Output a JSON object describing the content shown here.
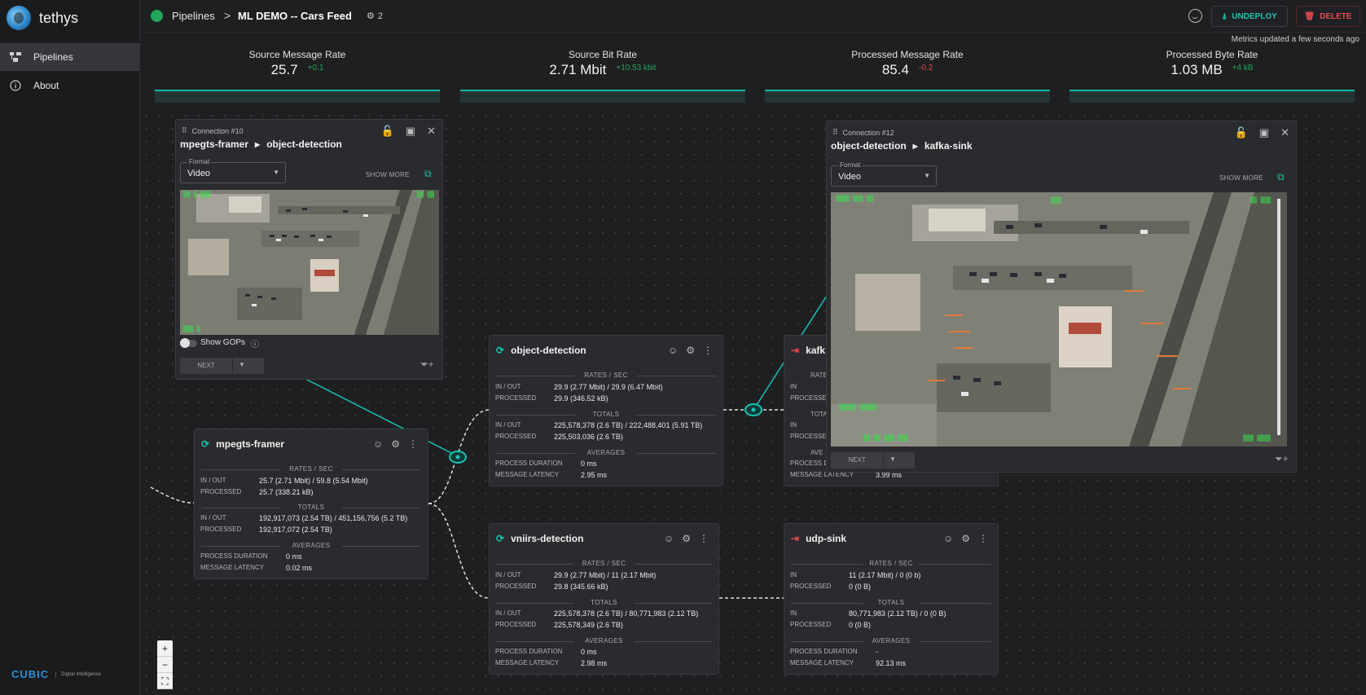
{
  "app": {
    "name": "tethys"
  },
  "sidebar": {
    "items": [
      {
        "label": "Pipelines",
        "icon": "pipelines-icon"
      },
      {
        "label": "About",
        "icon": "info-icon"
      }
    ],
    "footer": {
      "logo": "CUBIC",
      "sub": "Digital Intelligence"
    }
  },
  "header": {
    "breadcrumb_root": "Pipelines",
    "breadcrumb_sep": ">",
    "pipeline_name": "ML DEMO -- Cars Feed",
    "replica_count": "2",
    "undeploy_label": "UNDEPLOY",
    "delete_label": "DELETE",
    "status_color": "#23a55a"
  },
  "metrics": {
    "note": "Metrics updated a few seconds ago",
    "items": [
      {
        "label": "Source Message Rate",
        "value": "25.7",
        "delta": "+0.1"
      },
      {
        "label": "Source Bit Rate",
        "value": "2.71 Mbit",
        "delta": "+10.53 kbit"
      },
      {
        "label": "Processed Message Rate",
        "value": "85.4",
        "delta": "-0.2"
      },
      {
        "label": "Processed Byte Rate",
        "value": "1.03 MB",
        "delta": "+4 kB"
      }
    ]
  },
  "nodes": {
    "mpegts": {
      "title": "mpegts-framer",
      "rates_title": "RATES / SEC",
      "io_key": "IN / OUT",
      "io_val": "25.7 (2.71 Mbit)  /  59.8 (5.54 Mbit)",
      "proc_key": "PROCESSED",
      "proc_val": "25.7 (338.21 kB)",
      "totals_title": "TOTALS",
      "t_io_val": "192,917,073 (2.54 TB)  /  451,156,756 (5.2 TB)",
      "t_proc_val": "192,917,072 (2.54 TB)",
      "avg_title": "AVERAGES",
      "dur_key": "PROCESS DURATION",
      "dur_val": "0 ms",
      "lat_key": "MESSAGE LATENCY",
      "lat_val": "0.02 ms"
    },
    "objdet": {
      "title": "object-detection",
      "rates_title": "RATES / SEC",
      "io_key": "IN / OUT",
      "io_val": "29.9 (2.77 Mbit)  /  29.9 (6.47 Mbit)",
      "proc_key": "PROCESSED",
      "proc_val": "29.9 (346.52 kB)",
      "totals_title": "TOTALS",
      "t_io_val": "225,578,378 (2.6 TB)  /  222,488,401 (5.91 TB)",
      "t_proc_val": "225,503,036 (2.6 TB)",
      "avg_title": "AVERAGES",
      "dur_key": "PROCESS DURATION",
      "dur_val": "0 ms",
      "lat_key": "MESSAGE LATENCY",
      "lat_val": "2.95 ms"
    },
    "vniirs": {
      "title": "vniirs-detection",
      "rates_title": "RATES / SEC",
      "io_key": "IN / OUT",
      "io_val": "29.9 (2.77 Mbit)  /  11 (2.17 Mbit)",
      "proc_key": "PROCESSED",
      "proc_val": "29.8 (345.66 kB)",
      "totals_title": "TOTALS",
      "t_io_val": "225,578,378 (2.6 TB)  /  80,771,983 (2.12 TB)",
      "t_proc_val": "225,578,349 (2.6 TB)",
      "avg_title": "AVERAGES",
      "dur_key": "PROCESS DURATION",
      "dur_val": "0 ms",
      "lat_key": "MESSAGE LATENCY",
      "lat_val": "2.98 ms"
    },
    "udp": {
      "title": "udp-sink",
      "rates_title": "RATES / SEC",
      "io_key": "IN",
      "io_val": "11 (2.17 Mbit)  /  0 (0 b)",
      "proc_key": "PROCESSED",
      "proc_val": "0 (0 B)",
      "totals_title": "TOTALS",
      "t_io_key": "IN",
      "t_io_val": "80,771,983 (2.12 TB)  /  0 (0 B)",
      "t_proc_val": "0 (0 B)",
      "avg_title": "AVERAGES",
      "dur_key": "PROCESS DURATION",
      "dur_val": "-",
      "lat_key": "MESSAGE LATENCY",
      "lat_val": "92.13 ms"
    },
    "kafka": {
      "title": "kafk",
      "rates_title": "RATE",
      "io_key": "IN",
      "proc_key": "PROCESSE",
      "totals_title": "TOTA",
      "t_io_key": "IN",
      "t_proc_key": "PROCESSE",
      "avg_title": "AVE",
      "dur_key": "PROCESS D",
      "lat_key": "MESSAGE LATENCY",
      "lat_val": "3.99 ms"
    }
  },
  "panels": {
    "left": {
      "connection": "Connection #10",
      "from": "mpegts-framer",
      "to": "object-detection",
      "format_label": "Format",
      "format_value": "Video",
      "show_more": "SHOW MORE",
      "show_gops": "Show GOPs",
      "next": "NEXT"
    },
    "right": {
      "connection": "Connection #12",
      "from": "object-detection",
      "to": "kafka-sink",
      "format_label": "Format",
      "format_value": "Video",
      "show_more": "SHOW MORE",
      "next": "NEXT"
    }
  },
  "zoom": {
    "in": "+",
    "out": "−",
    "fit": "⛶"
  },
  "colors": {
    "accent": "#19c3b1",
    "danger": "#e5484d",
    "ok": "#23a55a"
  }
}
